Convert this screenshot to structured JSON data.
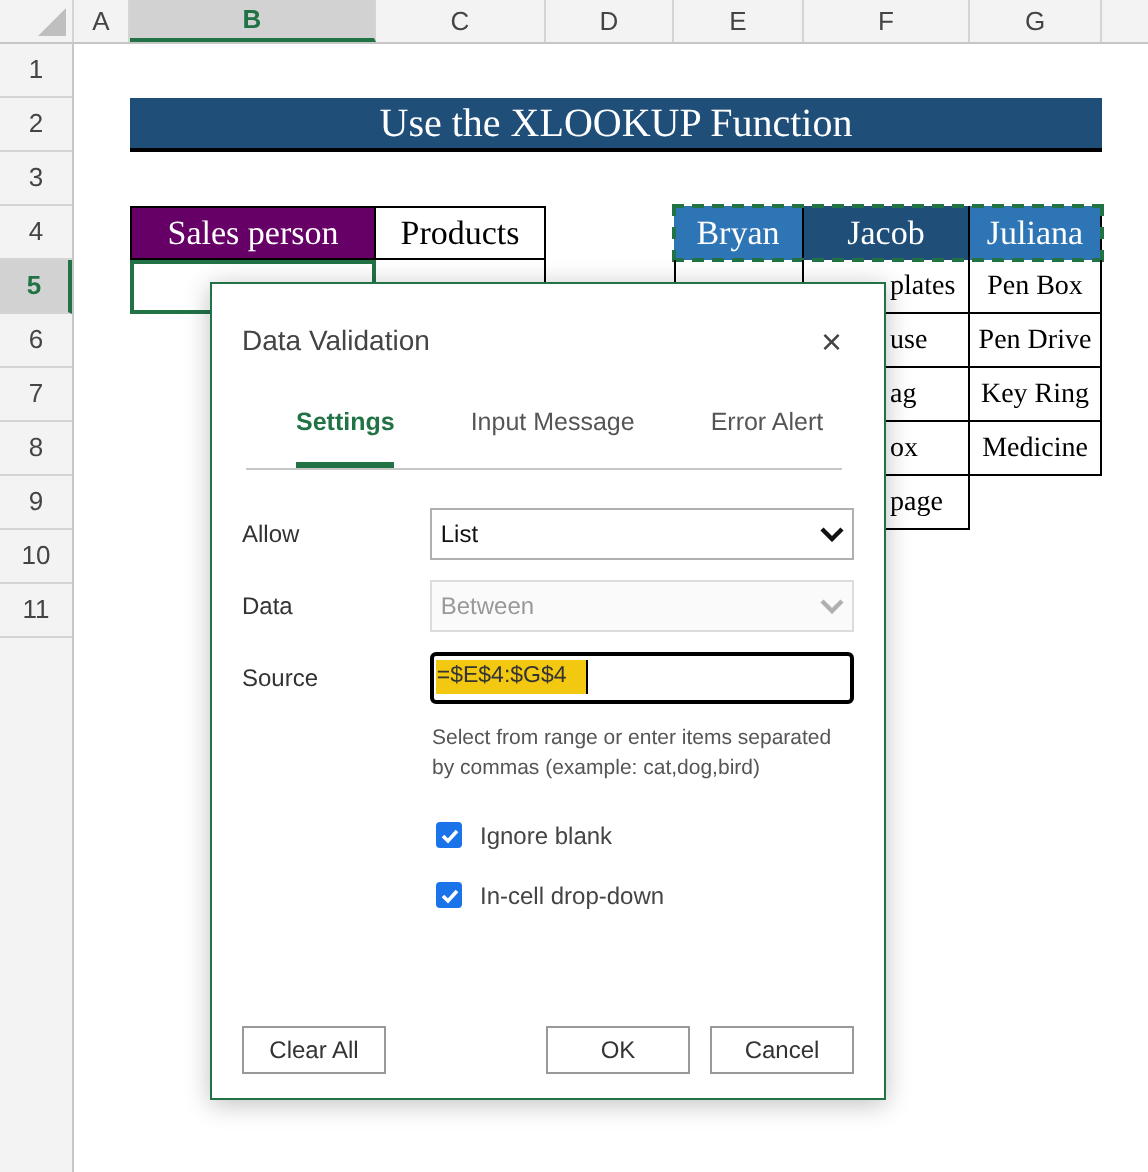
{
  "sheet": {
    "columns": [
      {
        "label": "A",
        "selected": false
      },
      {
        "label": "B",
        "selected": true
      },
      {
        "label": "C",
        "selected": false
      },
      {
        "label": "D",
        "selected": false
      },
      {
        "label": "E",
        "selected": false
      },
      {
        "label": "F",
        "selected": false
      },
      {
        "label": "G",
        "selected": false
      }
    ],
    "rows": [
      {
        "label": "1",
        "selected": false
      },
      {
        "label": "2",
        "selected": false
      },
      {
        "label": "3",
        "selected": false
      },
      {
        "label": "4",
        "selected": false
      },
      {
        "label": "5",
        "selected": true
      },
      {
        "label": "6",
        "selected": false
      },
      {
        "label": "7",
        "selected": false
      },
      {
        "label": "8",
        "selected": false
      },
      {
        "label": "9",
        "selected": false
      },
      {
        "label": "10",
        "selected": false
      },
      {
        "label": "11",
        "selected": false
      }
    ],
    "title": "Use the XLOOKUP Function",
    "input_table": {
      "headers": [
        {
          "label": "Sales person",
          "color": "#660066"
        },
        {
          "label": "Products",
          "color": "#ffffff"
        }
      ]
    },
    "lookup_table": {
      "headers": [
        {
          "label": "Bryan",
          "color": "#2e75b6"
        },
        {
          "label": "Jacob",
          "color": "#1f4e79"
        },
        {
          "label": "Juliana",
          "color": "#2e75b6"
        }
      ],
      "rows": [
        {
          "cells": [
            null,
            "plates",
            "Pen Box"
          ]
        },
        {
          "cells": [
            null,
            "use",
            "Pen Drive"
          ]
        },
        {
          "cells": [
            null,
            "ag",
            "Key Ring"
          ]
        },
        {
          "cells": [
            null,
            "ox",
            "Medicine"
          ]
        },
        {
          "cells": [
            null,
            "page",
            null
          ]
        }
      ]
    }
  },
  "dialog": {
    "title": "Data Validation",
    "close": "×",
    "tabs": [
      {
        "label": "Settings",
        "selected": true
      },
      {
        "label": "Input Message",
        "selected": false
      },
      {
        "label": "Error Alert",
        "selected": false
      }
    ],
    "fields": [
      {
        "label": "Allow",
        "kind": "select",
        "value": "List",
        "disabled": false
      },
      {
        "label": "Data",
        "kind": "select",
        "value": "Between",
        "disabled": true
      },
      {
        "label": "Source",
        "kind": "text",
        "value": "=$E$4:$G$4",
        "disabled": false
      }
    ],
    "help": "Select from range or enter items separated by commas (example: cat,dog,bird)",
    "checkboxes": [
      {
        "label": "Ignore blank",
        "checked": true
      },
      {
        "label": "In-cell drop-down",
        "checked": true
      }
    ],
    "buttons": [
      {
        "label": "Clear All",
        "kind": "left"
      },
      {
        "label": "OK",
        "kind": "right"
      },
      {
        "label": "Cancel",
        "kind": "right"
      }
    ]
  }
}
